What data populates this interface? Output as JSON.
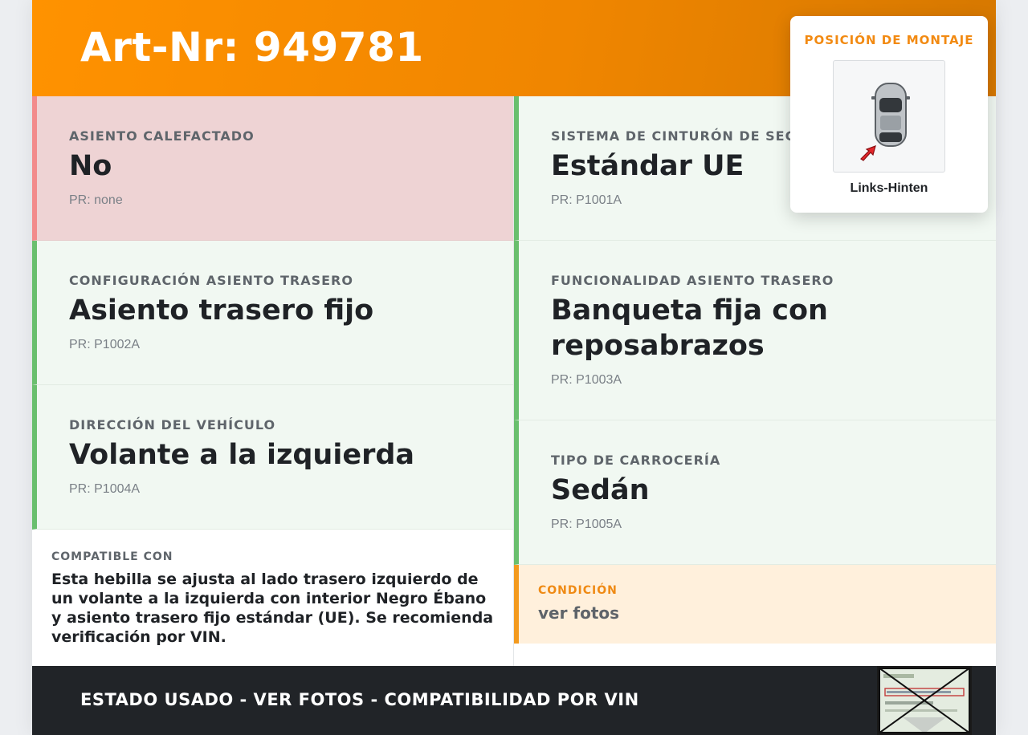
{
  "header": {
    "title": "Art-Nr: 949781"
  },
  "left_cells": [
    {
      "label": "ASIENTO CALEFACTADO",
      "value": "No",
      "pr": "PR: none",
      "status": "negative"
    },
    {
      "label": "CONFIGURACIÓN ASIENTO TRASERO",
      "value": "Asiento trasero fijo",
      "pr": "PR: P1002A",
      "status": "positive"
    },
    {
      "label": "DIRECCIÓN DEL VEHÍCULO",
      "value": "Volante a la izquierda",
      "pr": "PR: P1004A",
      "status": "positive"
    }
  ],
  "right_cells": [
    {
      "label": "SISTEMA DE CINTURÓN DE SEGUR",
      "value": "Estándar UE",
      "pr": "PR: P1001A",
      "status": "positive"
    },
    {
      "label": "FUNCIONALIDAD ASIENTO TRASERO",
      "value": "Banqueta fija con reposabrazos",
      "pr": "PR: P1003A",
      "status": "positive"
    },
    {
      "label": "TIPO DE CARROCERÍA",
      "value": "Sedán",
      "pr": "PR: P1005A",
      "status": "positive"
    }
  ],
  "compatible": {
    "label": "COMPATIBLE CON",
    "text": "Esta hebilla se ajusta al lado trasero izquierdo de un volante a la izquierda con interior Negro Ébano y asiento trasero fijo estándar (UE). Se recomienda verificación por VIN."
  },
  "condition": {
    "label": "CONDICIÓN",
    "text": "ver fotos"
  },
  "mount": {
    "title": "POSICIÓN DE MONTAJE",
    "position": "Links-Hinten"
  },
  "footer": {
    "text": "ESTADO USADO - VER FOTOS - COMPATIBILIDAD POR VIN"
  },
  "colors": {
    "accent": "#f28a12",
    "positive_border": "#6abf6e",
    "negative_border": "#f28b8b",
    "negative_bg": "#eed3d4",
    "positive_bg": "#f1f8f2",
    "footer_bg": "#212428"
  }
}
